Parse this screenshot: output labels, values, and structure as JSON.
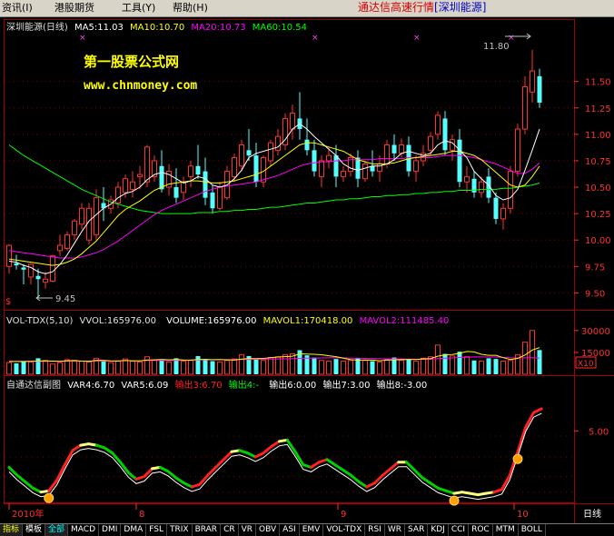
{
  "menubar": {
    "items": [
      {
        "name": "menu-zixun",
        "label": "资讯(I)"
      },
      {
        "name": "menu-ganggu",
        "label": "港股期货"
      },
      {
        "name": "menu-gongju",
        "label": "工具(Y)"
      },
      {
        "name": "menu-bangzhu",
        "label": "帮助(H)"
      }
    ],
    "title_main": "通达信高速行情",
    "title_stock": "[深圳能源]"
  },
  "colors": {
    "up": "#ff3232",
    "down": "#54ffff",
    "ma5": "#ffffff",
    "ma10": "#ffff00",
    "ma20": "#ff00ff",
    "ma60": "#00ff00",
    "grid": "#7a0000",
    "axis_text": "#ff3030"
  },
  "price_panel": {
    "header": {
      "stock": "深圳能源(日线)",
      "ma5": "MA5:11.03",
      "ma10": "MA10:10.70",
      "ma20": "MA20:10.73",
      "ma60": "MA60:10.54"
    },
    "watermark_line1": "第一股票公式网",
    "watermark_line2": "www.chnmoney.com",
    "high_label": "11.80",
    "low_label": "9.45",
    "dollar_marker": "$",
    "y_axis": [
      "11.50",
      "11.25",
      "11.00",
      "10.75",
      "10.50",
      "10.25",
      "10.00",
      "9.75",
      "9.50"
    ],
    "candles": [
      [
        9.75,
        9.96,
        9.95,
        9.68
      ],
      [
        9.78,
        9.86,
        9.76,
        9.72
      ],
      [
        9.74,
        9.77,
        9.72,
        9.58
      ],
      [
        9.65,
        9.78,
        9.77,
        9.58
      ],
      [
        9.66,
        9.73,
        9.63,
        9.45
      ],
      [
        9.6,
        9.7,
        9.63,
        9.54
      ],
      [
        9.61,
        9.86,
        9.85,
        9.6
      ],
      [
        9.9,
        10.05,
        9.95,
        9.85
      ],
      [
        9.92,
        10.08,
        10.05,
        9.9
      ],
      [
        10.05,
        10.2,
        10.18,
        10.0
      ],
      [
        10.15,
        10.35,
        10.3,
        10.1
      ],
      [
        10.0,
        10.35,
        10.3,
        9.96
      ],
      [
        10.05,
        10.48,
        10.4,
        10.0
      ],
      [
        10.35,
        10.5,
        10.3,
        10.18
      ],
      [
        10.3,
        10.42,
        10.38,
        10.25
      ],
      [
        10.35,
        10.55,
        10.5,
        10.3
      ],
      [
        10.45,
        10.62,
        10.58,
        10.4
      ],
      [
        10.48,
        10.65,
        10.55,
        10.4
      ],
      [
        10.6,
        10.7,
        10.62,
        10.48
      ],
      [
        10.55,
        10.9,
        10.88,
        10.5
      ],
      [
        10.6,
        10.8,
        10.75,
        10.55
      ],
      [
        10.7,
        10.85,
        10.48,
        10.45
      ],
      [
        10.5,
        10.72,
        10.65,
        10.42
      ],
      [
        10.5,
        10.68,
        10.4,
        10.35
      ],
      [
        10.45,
        10.6,
        10.55,
        10.38
      ],
      [
        10.6,
        10.75,
        10.7,
        10.5
      ],
      [
        10.7,
        10.9,
        10.62,
        10.58
      ],
      [
        10.65,
        10.78,
        10.4,
        10.33
      ],
      [
        10.45,
        10.52,
        10.3,
        10.25
      ],
      [
        10.3,
        10.55,
        10.5,
        10.28
      ],
      [
        10.4,
        10.7,
        10.65,
        10.38
      ],
      [
        10.6,
        10.82,
        10.78,
        10.55
      ],
      [
        10.7,
        10.95,
        10.9,
        10.65
      ],
      [
        10.85,
        11.05,
        10.8,
        10.75
      ],
      [
        10.8,
        10.92,
        10.55,
        10.5
      ],
      [
        10.55,
        10.8,
        10.78,
        10.5
      ],
      [
        10.75,
        10.95,
        10.92,
        10.7
      ],
      [
        10.85,
        11.05,
        10.98,
        10.8
      ],
      [
        10.9,
        11.2,
        11.15,
        10.85
      ],
      [
        11.05,
        11.28,
        11.2,
        10.95
      ],
      [
        11.15,
        11.4,
        11.05,
        10.95
      ],
      [
        10.95,
        11.15,
        10.85,
        10.8
      ],
      [
        10.85,
        10.95,
        10.65,
        10.6
      ],
      [
        10.6,
        10.8,
        10.75,
        10.5
      ],
      [
        10.75,
        10.88,
        10.8,
        10.68
      ],
      [
        10.8,
        10.9,
        10.6,
        10.5
      ],
      [
        10.6,
        10.7,
        10.65,
        10.55
      ],
      [
        10.65,
        10.82,
        10.78,
        10.6
      ],
      [
        10.78,
        10.85,
        10.58,
        10.5
      ],
      [
        10.58,
        10.75,
        10.72,
        10.55
      ],
      [
        10.7,
        10.85,
        10.65,
        10.6
      ],
      [
        10.65,
        10.8,
        10.72,
        10.55
      ],
      [
        10.72,
        10.95,
        10.9,
        10.68
      ],
      [
        10.9,
        11.0,
        10.82,
        10.75
      ],
      [
        10.82,
        10.96,
        10.9,
        10.78
      ],
      [
        10.9,
        10.98,
        10.65,
        10.6
      ],
      [
        10.65,
        10.8,
        10.75,
        10.55
      ],
      [
        10.75,
        10.9,
        10.82,
        10.7
      ],
      [
        10.85,
        11.02,
        10.98,
        10.8
      ],
      [
        11.0,
        11.22,
        11.18,
        10.95
      ],
      [
        11.15,
        11.22,
        10.85,
        10.8
      ],
      [
        10.85,
        11.0,
        10.95,
        10.75
      ],
      [
        10.95,
        11.05,
        10.55,
        10.5
      ],
      [
        10.55,
        10.7,
        10.6,
        10.45
      ],
      [
        10.58,
        10.65,
        10.45,
        10.4
      ],
      [
        10.45,
        10.6,
        10.55,
        10.4
      ],
      [
        10.6,
        10.68,
        10.4,
        10.35
      ],
      [
        10.4,
        10.45,
        10.2,
        10.15
      ],
      [
        10.2,
        10.35,
        10.3,
        10.1
      ],
      [
        10.3,
        10.7,
        10.65,
        10.25
      ],
      [
        10.65,
        11.1,
        11.05,
        10.6
      ],
      [
        11.05,
        11.55,
        11.45,
        11.0
      ],
      [
        11.4,
        11.8,
        11.6,
        11.3
      ],
      [
        11.55,
        11.62,
        11.3,
        11.25
      ]
    ],
    "ma5": [
      9.8,
      9.79,
      9.76,
      9.74,
      9.7,
      9.68,
      9.7,
      9.77,
      9.86,
      9.97,
      10.08,
      10.18,
      10.24,
      10.3,
      10.34,
      10.4,
      10.44,
      10.46,
      10.5,
      10.57,
      10.62,
      10.64,
      10.62,
      10.58,
      10.54,
      10.56,
      10.6,
      10.58,
      10.52,
      10.5,
      10.52,
      10.58,
      10.66,
      10.78,
      10.82,
      10.84,
      10.86,
      10.88,
      10.95,
      11.05,
      11.1,
      11.05,
      10.98,
      10.92,
      10.86,
      10.8,
      10.72,
      10.68,
      10.66,
      10.68,
      10.7,
      10.7,
      10.72,
      10.76,
      10.82,
      10.84,
      10.82,
      10.8,
      10.82,
      10.9,
      10.94,
      10.92,
      10.85,
      10.78,
      10.65,
      10.58,
      10.52,
      10.42,
      10.38,
      10.4,
      10.48,
      10.66,
      10.85,
      11.05
    ],
    "ma10": [
      9.82,
      9.81,
      9.8,
      9.79,
      9.78,
      9.77,
      9.76,
      9.77,
      9.79,
      9.82,
      9.87,
      9.93,
      9.99,
      10.07,
      10.15,
      10.23,
      10.29,
      10.33,
      10.37,
      10.42,
      10.47,
      10.5,
      10.53,
      10.54,
      10.55,
      10.56,
      10.56,
      10.55,
      10.54,
      10.54,
      10.55,
      10.56,
      10.58,
      10.6,
      10.62,
      10.65,
      10.7,
      10.75,
      10.8,
      10.85,
      10.9,
      10.92,
      10.92,
      10.9,
      10.88,
      10.86,
      10.84,
      10.8,
      10.76,
      10.74,
      10.72,
      10.72,
      10.72,
      10.73,
      10.75,
      10.77,
      10.78,
      10.79,
      10.8,
      10.81,
      10.82,
      10.84,
      10.84,
      10.82,
      10.8,
      10.76,
      10.7,
      10.64,
      10.58,
      10.52,
      10.5,
      10.52,
      10.6,
      10.7
    ],
    "ma20": [
      9.9,
      9.89,
      9.88,
      9.87,
      9.86,
      9.85,
      9.84,
      9.83,
      9.83,
      9.83,
      9.84,
      9.86,
      9.88,
      9.91,
      9.95,
      9.99,
      10.04,
      10.09,
      10.14,
      10.19,
      10.24,
      10.28,
      10.31,
      10.34,
      10.37,
      10.4,
      10.43,
      10.46,
      10.48,
      10.5,
      10.51,
      10.52,
      10.53,
      10.54,
      10.55,
      10.57,
      10.59,
      10.61,
      10.64,
      10.67,
      10.7,
      10.72,
      10.73,
      10.74,
      10.74,
      10.75,
      10.75,
      10.76,
      10.76,
      10.76,
      10.76,
      10.77,
      10.77,
      10.77,
      10.77,
      10.78,
      10.78,
      10.78,
      10.78,
      10.79,
      10.8,
      10.8,
      10.8,
      10.79,
      10.78,
      10.76,
      10.74,
      10.72,
      10.69,
      10.66,
      10.63,
      10.63,
      10.67,
      10.73
    ],
    "ma60": [
      10.9,
      10.85,
      10.8,
      10.76,
      10.72,
      10.68,
      10.64,
      10.6,
      10.56,
      10.52,
      10.48,
      10.45,
      10.42,
      10.39,
      10.36,
      10.34,
      10.32,
      10.3,
      10.28,
      10.27,
      10.26,
      10.25,
      10.25,
      10.25,
      10.25,
      10.25,
      10.26,
      10.26,
      10.26,
      10.27,
      10.27,
      10.28,
      10.28,
      10.29,
      10.29,
      10.3,
      10.31,
      10.31,
      10.32,
      10.33,
      10.34,
      10.35,
      10.35,
      10.36,
      10.37,
      10.38,
      10.38,
      10.39,
      10.39,
      10.4,
      10.41,
      10.41,
      10.42,
      10.42,
      10.43,
      10.43,
      10.44,
      10.44,
      10.45,
      10.45,
      10.46,
      10.46,
      10.47,
      10.47,
      10.47,
      10.48,
      10.48,
      10.48,
      10.49,
      10.49,
      10.5,
      10.51,
      10.52,
      10.54
    ]
  },
  "volume_panel": {
    "header": {
      "name": "VOL-TDX(5,10)",
      "vvol": "VVOL:165976.00",
      "volume": "VOLUME:165976.00",
      "mavol1": "MAVOL1:170418.00",
      "mavol2": "MAVOL2:111485.40"
    },
    "y_axis": [
      "30000",
      "15000"
    ],
    "unit": "X10",
    "volumes": [
      8000,
      7500,
      9000,
      8500,
      11000,
      9500,
      7000,
      8000,
      10000,
      9500,
      9000,
      8500,
      11000,
      9500,
      8000,
      9000,
      10500,
      9000,
      8500,
      12000,
      10000,
      9500,
      8500,
      11000,
      9000,
      9500,
      12500,
      10500,
      9000,
      8500,
      9500,
      10500,
      13500,
      12500,
      10000,
      9500,
      11500,
      12000,
      13500,
      14000,
      16500,
      13000,
      11500,
      9500,
      9000,
      10500,
      9000,
      9500,
      11000,
      9500,
      9000,
      8500,
      10000,
      11500,
      9500,
      10500,
      9000,
      11000,
      12000,
      20000,
      14000,
      12500,
      15500,
      12000,
      9500,
      9000,
      11000,
      10500,
      9000,
      9500,
      13500,
      22000,
      30000,
      16597
    ],
    "mavol1": [
      8800,
      8700,
      8800,
      8900,
      9100,
      9200,
      9000,
      8900,
      9300,
      9400,
      9000,
      8900,
      9600,
      9600,
      9200,
      9100,
      9500,
      9200,
      9200,
      9800,
      9900,
      10200,
      9900,
      10100,
      9800,
      9700,
      10100,
      10200,
      10000,
      10100,
      9900,
      9700,
      10400,
      10700,
      10800,
      10900,
      11400,
      11800,
      12100,
      12400,
      14000,
      13800,
      13700,
      13400,
      12700,
      12100,
      11000,
      10000,
      9700,
      9800,
      9700,
      9300,
      9700,
      9900,
      10000,
      10100,
      10100,
      10600,
      10800,
      12400,
      13400,
      13500,
      14400,
      15600,
      15300,
      13700,
      13000,
      13000,
      11400,
      10100,
      10900,
      13200,
      16600,
      18300
    ],
    "mavol2": [
      8900,
      8900,
      8900,
      8900,
      8900,
      8900,
      8900,
      8900,
      9000,
      9000,
      9000,
      9000,
      9100,
      9100,
      9100,
      9200,
      9300,
      9300,
      9300,
      9400,
      9500,
      9500,
      9500,
      9600,
      9700,
      9700,
      9800,
      9900,
      9900,
      10000,
      10000,
      10000,
      10100,
      10200,
      10300,
      10300,
      10400,
      10500,
      10600,
      10700,
      10900,
      11000,
      11100,
      11200,
      11300,
      11400,
      11300,
      11100,
      11000,
      10900,
      10800,
      10700,
      10600,
      10500,
      10500,
      10400,
      10300,
      10300,
      10300,
      10800,
      11100,
      11200,
      11500,
      11700,
      11900,
      11900,
      11800,
      11800,
      11600,
      11300,
      11200,
      11300,
      11400,
      11100
    ],
    "marker": "VVOL"
  },
  "indicator_panel": {
    "header": {
      "name": "自通达信副图",
      "var4": "VAR4:6.70",
      "var5": "VAR5:6.09",
      "out3": "输出3:6.70",
      "out4": "输出4:-",
      "out6": "输出6:0.00",
      "out7": "输出7:3.00",
      "out8": "输出8:-3.00"
    },
    "y_axis": [
      "5.00"
    ],
    "line": [
      2.2,
      1.6,
      1.1,
      0.6,
      0.3,
      0.4,
      1.2,
      2.4,
      3.5,
      3.9,
      4.0,
      3.9,
      3.7,
      3.3,
      2.6,
      1.8,
      1.3,
      1.5,
      2.1,
      2.2,
      1.9,
      1.4,
      1.0,
      0.7,
      0.9,
      1.6,
      2.2,
      2.8,
      3.4,
      3.5,
      3.3,
      3.0,
      3.3,
      3.8,
      4.2,
      4.3,
      3.4,
      2.4,
      2.2,
      2.6,
      2.8,
      2.4,
      2.0,
      1.6,
      1.1,
      0.7,
      1.0,
      1.6,
      2.1,
      2.6,
      2.6,
      2.0,
      1.4,
      1.0,
      0.6,
      0.4,
      0.2,
      0.3,
      0.2,
      0.1,
      0.2,
      0.3,
      0.5,
      1.6,
      3.4,
      5.3,
      6.4,
      6.7
    ],
    "signal_points": [
      5,
      56,
      64
    ]
  },
  "x_axis": {
    "labels": [
      "2010年",
      "8",
      "9",
      "10"
    ],
    "period": "日线"
  },
  "tabs": [
    {
      "label": "指标",
      "style": "sel-yellow"
    },
    {
      "label": "模板",
      "style": "normal"
    },
    {
      "label": "全部",
      "style": "sel-cyan"
    },
    {
      "label": "MACD",
      "style": "normal"
    },
    {
      "label": "DMI",
      "style": "normal"
    },
    {
      "label": "DMA",
      "style": "normal"
    },
    {
      "label": "FSL",
      "style": "normal"
    },
    {
      "label": "TRIX",
      "style": "normal"
    },
    {
      "label": "BRAR",
      "style": "normal"
    },
    {
      "label": "CR",
      "style": "normal"
    },
    {
      "label": "VR",
      "style": "normal"
    },
    {
      "label": "OBV",
      "style": "normal"
    },
    {
      "label": "ASI",
      "style": "normal"
    },
    {
      "label": "EMV",
      "style": "normal"
    },
    {
      "label": "VOL-TDX",
      "style": "normal"
    },
    {
      "label": "RSI",
      "style": "normal"
    },
    {
      "label": "WR",
      "style": "normal"
    },
    {
      "label": "SAR",
      "style": "normal"
    },
    {
      "label": "KDJ",
      "style": "normal"
    },
    {
      "label": "CCI",
      "style": "normal"
    },
    {
      "label": "ROC",
      "style": "normal"
    },
    {
      "label": "MTM",
      "style": "normal"
    },
    {
      "label": "BOLL",
      "style": "normal"
    }
  ]
}
